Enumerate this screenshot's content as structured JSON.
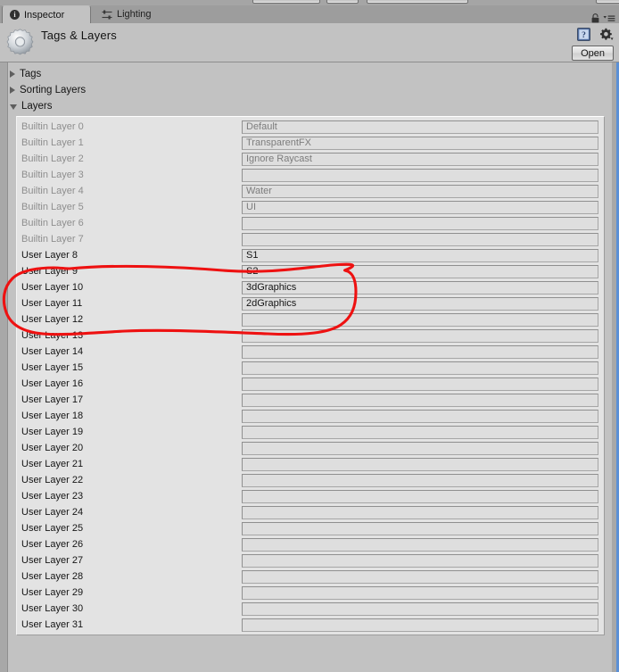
{
  "window": {
    "accent_border_color": "#5b90d6",
    "panel_bg": "#c2c2c2",
    "list_bg": "#e3e3e3",
    "annotation_color": "#ee1111"
  },
  "tabs": [
    {
      "label": "Inspector",
      "icon": "info-circle-icon",
      "active": true
    },
    {
      "label": "Lighting",
      "icon": "lighting-sliders-icon",
      "active": false
    }
  ],
  "header": {
    "title": "Tags & Layers",
    "icon": "gear-icon",
    "lock_icon": "lock-icon",
    "menu_icon": "hamburger-menu-icon",
    "help_icon": "help-book-icon",
    "settings_icon": "gear-dropdown-icon",
    "open_label": "Open"
  },
  "foldouts": [
    {
      "label": "Tags",
      "expanded": false
    },
    {
      "label": "Sorting Layers",
      "expanded": false
    },
    {
      "label": "Layers",
      "expanded": true
    }
  ],
  "layers": [
    {
      "label": "Builtin Layer 0",
      "value": "Default",
      "builtin": true
    },
    {
      "label": "Builtin Layer 1",
      "value": "TransparentFX",
      "builtin": true
    },
    {
      "label": "Builtin Layer 2",
      "value": "Ignore Raycast",
      "builtin": true
    },
    {
      "label": "Builtin Layer 3",
      "value": "",
      "builtin": true
    },
    {
      "label": "Builtin Layer 4",
      "value": "Water",
      "builtin": true
    },
    {
      "label": "Builtin Layer 5",
      "value": "UI",
      "builtin": true
    },
    {
      "label": "Builtin Layer 6",
      "value": "",
      "builtin": true
    },
    {
      "label": "Builtin Layer 7",
      "value": "",
      "builtin": true
    },
    {
      "label": "User Layer 8",
      "value": "S1",
      "builtin": false
    },
    {
      "label": "User Layer 9",
      "value": "S2",
      "builtin": false
    },
    {
      "label": "User Layer 10",
      "value": "3dGraphics",
      "builtin": false
    },
    {
      "label": "User Layer 11",
      "value": "2dGraphics",
      "builtin": false
    },
    {
      "label": "User Layer 12",
      "value": "",
      "builtin": false
    },
    {
      "label": "User Layer 13",
      "value": "",
      "builtin": false
    },
    {
      "label": "User Layer 14",
      "value": "",
      "builtin": false
    },
    {
      "label": "User Layer 15",
      "value": "",
      "builtin": false
    },
    {
      "label": "User Layer 16",
      "value": "",
      "builtin": false
    },
    {
      "label": "User Layer 17",
      "value": "",
      "builtin": false
    },
    {
      "label": "User Layer 18",
      "value": "",
      "builtin": false
    },
    {
      "label": "User Layer 19",
      "value": "",
      "builtin": false
    },
    {
      "label": "User Layer 20",
      "value": "",
      "builtin": false
    },
    {
      "label": "User Layer 21",
      "value": "",
      "builtin": false
    },
    {
      "label": "User Layer 22",
      "value": "",
      "builtin": false
    },
    {
      "label": "User Layer 23",
      "value": "",
      "builtin": false
    },
    {
      "label": "User Layer 24",
      "value": "",
      "builtin": false
    },
    {
      "label": "User Layer 25",
      "value": "",
      "builtin": false
    },
    {
      "label": "User Layer 26",
      "value": "",
      "builtin": false
    },
    {
      "label": "User Layer 27",
      "value": "",
      "builtin": false
    },
    {
      "label": "User Layer 28",
      "value": "",
      "builtin": false
    },
    {
      "label": "User Layer 29",
      "value": "",
      "builtin": false
    },
    {
      "label": "User Layer 30",
      "value": "",
      "builtin": false
    },
    {
      "label": "User Layer 31",
      "value": "",
      "builtin": false
    }
  ],
  "annotation": {
    "shape": "hand-drawn-ellipse",
    "color": "#ee1111",
    "highlights": [
      "User Layer 9",
      "User Layer 10",
      "User Layer 11",
      "User Layer 12"
    ]
  }
}
